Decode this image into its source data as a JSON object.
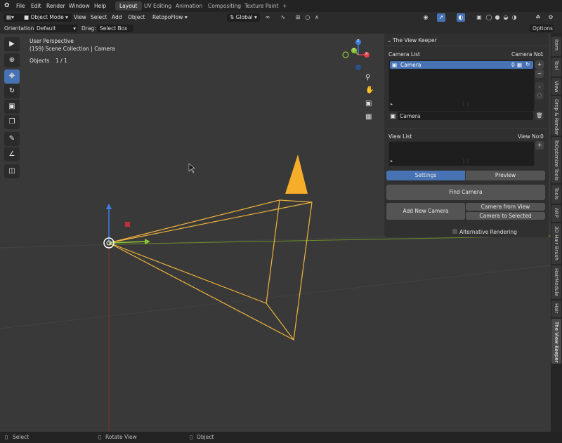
{
  "menu": {
    "items": [
      "File",
      "Edit",
      "Render",
      "Window",
      "Help"
    ],
    "workspaces": [
      "Layout",
      "UV Editing",
      "Animation",
      "Compositing",
      "Texture Paint"
    ],
    "active_workspace": "Layout",
    "add_tab": "+"
  },
  "header": {
    "mode": "Object Mode",
    "menus": [
      "View",
      "Select",
      "Add",
      "Object",
      "RetopoFlow"
    ],
    "transform_orientation": "Global",
    "options": "Options"
  },
  "tool_settings": {
    "orientation_label": "Orientation:",
    "orientation_value": "Default",
    "drag_label": "Drag:",
    "drag_value": "Select Box"
  },
  "viewport": {
    "view_name": "User Perspective",
    "collection_line": "(159) Scene Collection | Camera",
    "objects_label": "Objects",
    "objects_count": "1 / 1",
    "gizmo_axes": [
      "Z",
      "X",
      "Y"
    ]
  },
  "panel": {
    "title": "The View Keeper",
    "camera_list_label": "Camera List",
    "camera_no_label": "Camera No:",
    "camera_no_value": "1",
    "camera_item": "Camera",
    "camera_item_index": "0",
    "camera_field": "Camera",
    "view_list_label": "View List",
    "view_no_label": "View No:",
    "view_no_value": "0",
    "tabs": [
      "Settings",
      "Preview"
    ],
    "active_tab": "Settings",
    "find_camera": "Find Camera",
    "add_new_camera": "Add New Camera",
    "camera_from_view": "Camera from View",
    "camera_to_selected": "Camera to Selected",
    "alt_rendering": "Alternative Rendering"
  },
  "right_tabs": [
    "Item",
    "Tool",
    "View",
    "Drop & Render",
    "ToOptimize Tools",
    "Tools",
    "ARP",
    "3D Hair Brush",
    "HairModule",
    "Hair",
    "The View Keeper"
  ],
  "active_right_tab": "The View Keeper",
  "status": {
    "select": "Select",
    "rotate": "Rotate View",
    "object": "Object"
  },
  "colors": {
    "accent": "#4772b3",
    "camera_outline": "#f0b43c",
    "x_axis": "#e0424a",
    "y_axis": "#8fc43a",
    "z_axis": "#3d7fe0"
  }
}
